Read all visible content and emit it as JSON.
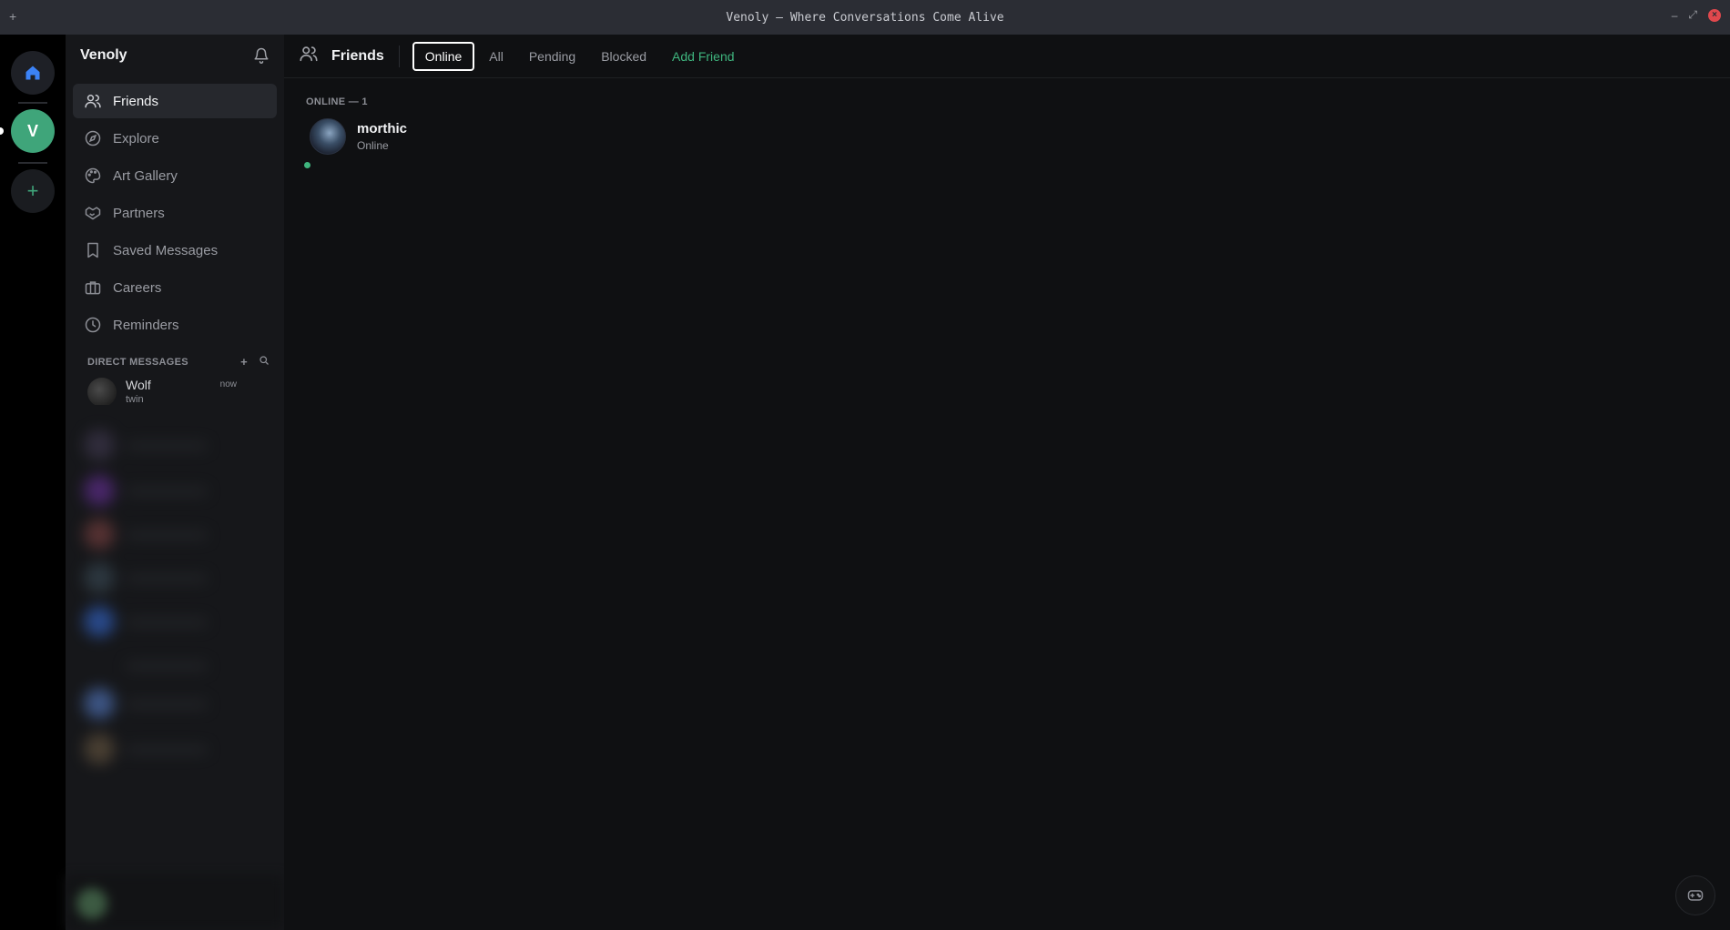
{
  "window": {
    "title": "Venoly — Where Conversations Come Alive",
    "pin_icon": "plus-icon"
  },
  "rail": {
    "home_icon": "home-icon",
    "server_initial": "V",
    "add_label": "+"
  },
  "sidebar": {
    "title": "Venoly",
    "items": [
      {
        "label": "Friends",
        "icon": "friends-icon",
        "active": true
      },
      {
        "label": "Explore",
        "icon": "compass-icon"
      },
      {
        "label": "Art Gallery",
        "icon": "palette-icon"
      },
      {
        "label": "Partners",
        "icon": "handshake-icon"
      },
      {
        "label": "Saved Messages",
        "icon": "bookmark-icon"
      },
      {
        "label": "Careers",
        "icon": "briefcase-icon"
      },
      {
        "label": "Reminders",
        "icon": "clock-icon"
      }
    ],
    "dm_header": "DIRECT MESSAGES",
    "dms": [
      {
        "name": "Wolf",
        "sub": "twin",
        "time": "now"
      }
    ]
  },
  "main": {
    "title": "Friends",
    "tabs": [
      {
        "label": "Online",
        "active": true
      },
      {
        "label": "All"
      },
      {
        "label": "Pending"
      },
      {
        "label": "Blocked"
      },
      {
        "label": "Add Friend",
        "accent": true
      }
    ],
    "section_label": "ONLINE — 1",
    "friends": [
      {
        "name": "morthic",
        "status": "Online"
      }
    ]
  },
  "colors": {
    "accent_green": "#3fb57e",
    "home_blue": "#3b82f6",
    "close_red": "#e0484d"
  }
}
